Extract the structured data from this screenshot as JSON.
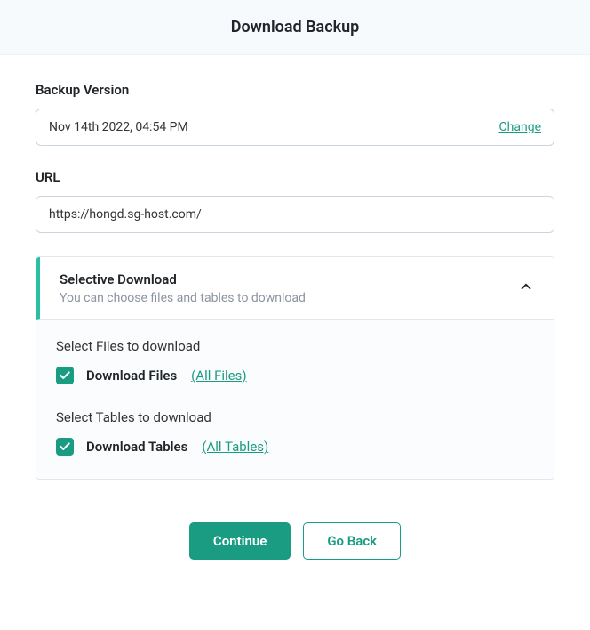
{
  "header": {
    "title": "Download Backup"
  },
  "backup_version": {
    "label": "Backup Version",
    "value": "Nov 14th 2022, 04:54 PM",
    "change_label": "Change"
  },
  "url": {
    "label": "URL",
    "value": "https://hongd.sg-host.com/"
  },
  "selective": {
    "title": "Selective Download",
    "subtitle": "You can choose files and tables to download",
    "files": {
      "label": "Select Files to download",
      "checkbox_label": "Download Files",
      "link_label": "(All Files)",
      "checked": true
    },
    "tables": {
      "label": "Select Tables to download",
      "checkbox_label": "Download Tables",
      "link_label": "(All Tables)",
      "checked": true
    }
  },
  "buttons": {
    "continue": "Continue",
    "go_back": "Go Back"
  }
}
